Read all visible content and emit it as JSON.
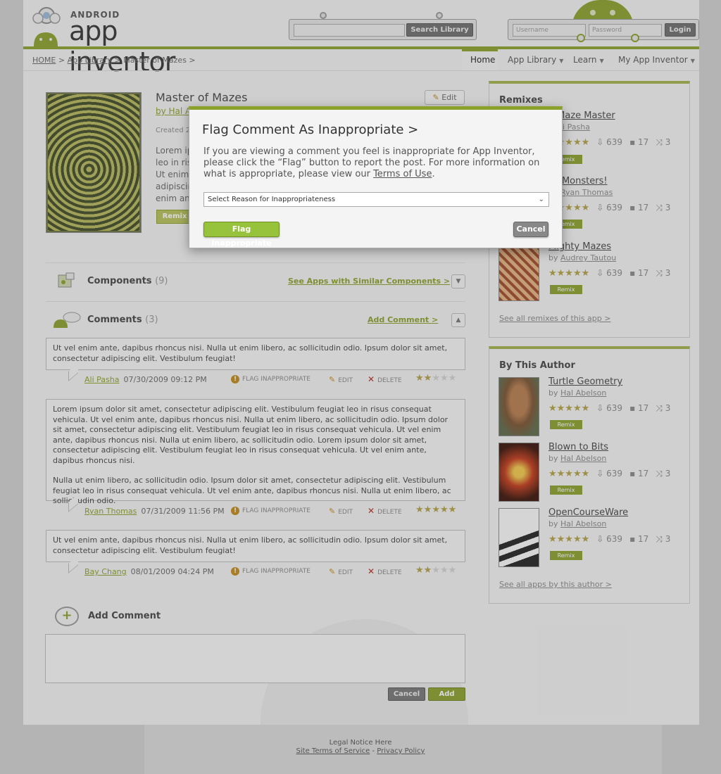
{
  "header": {
    "logo_small": "ANDROID",
    "logo_text": "app inventor",
    "search_button": "Search Library",
    "username_placeholder": "Username",
    "password_placeholder": "Password",
    "login_button": "Login"
  },
  "breadcrumb": {
    "home": "HOME",
    "sep1": " > ",
    "library": "App Library",
    "sep2": " > ",
    "current": "Master of Mazes >"
  },
  "nav": {
    "home": "Home",
    "library": "App Library",
    "learn": "Learn",
    "my": "My App Inventor",
    "chevron": "▼"
  },
  "app": {
    "title": "Master of Mazes",
    "by": "by Hal A",
    "created": "Created  2",
    "desc_lines": [
      "Lorem ip",
      "leo in ris",
      "Ut enim",
      "adipiscin",
      "enim an"
    ],
    "edit_label": "Edit",
    "remix_label": "Remix"
  },
  "components": {
    "title": "Components",
    "count": "(9)",
    "link": "See Apps with Similar Components >"
  },
  "comments": {
    "title": "Comments",
    "count": "(3)",
    "link": "Add Comment >",
    "flag_label": "FLAG INAPPROPRIATE",
    "edit_label": "EDIT",
    "delete_label": "DELETE",
    "items": [
      {
        "paragraphs": [
          "Ut vel enim ante, dapibus rhoncus nisi. Nulla ut enim libero, ac sollicitudin odio.  Ipsum dolor sit amet, consectetur adipiscing elit. Vestibulum feugiat!"
        ],
        "author": "Ali Pasha",
        "date": "07/30/2009 09:12 PM",
        "rating": 2
      },
      {
        "paragraphs": [
          "Lorem ipsum dolor sit amet, consectetur adipiscing elit. Vestibulum feugiat leo in risus consequat vehicula. Ut vel enim ante, dapibus rhoncus nisi. Nulla ut enim libero, ac sollicitudin odio.  Ipsum dolor sit amet, consectetur adipiscing elit. Vestibulum feugiat leo in risus consequat vehicula. Ut vel enim ante, dapibus rhoncus nisi. Nulla ut enim libero, ac sollicitudin odio. Lorem ipsum dolor sit amet, consectetur adipiscing elit. Vestibulum feugiat leo in risus consequat vehicula. Ut vel enim ante, dapibus rhoncus nisi.",
          "Nulla ut enim libero, ac sollicitudin odio.  Ipsum dolor sit amet, consectetur adipiscing elit. Vestibulum feugiat leo in risus consequat vehicula. Ut vel enim ante, dapibus rhoncus nisi. Nulla ut enim libero, ac sollicitudin odio."
        ],
        "author": "Ryan Thomas",
        "date": "07/31/2009 11:56 PM",
        "rating": 5
      },
      {
        "paragraphs": [
          "Ut vel enim ante, dapibus rhoncus nisi. Nulla ut enim libero, ac sollicitudin odio.  Ipsum dolor sit amet, consectetur adipiscing elit. Vestibulum feugiat!"
        ],
        "author": "Bay Chang",
        "date": "08/01/2009 04:24 PM",
        "rating": 2
      }
    ]
  },
  "add_comment": {
    "title": "Add Comment",
    "cancel": "Cancel",
    "add": "Add"
  },
  "remixes": {
    "title": "Remixes",
    "see_all": "See all remixes of this app >",
    "items": [
      {
        "title": "e Maze Master",
        "by_prefix": "by ",
        "author": "li Pasha",
        "downloads": "639",
        "comments": "17",
        "remixes": "3",
        "remix": "Remix"
      },
      {
        "title": "ze Monsters!",
        "by_prefix": "by ",
        "author": "Ryan Thomas",
        "downloads": "639",
        "comments": "17",
        "remixes": "3",
        "remix": "Remix"
      },
      {
        "title": "Mighty Mazes",
        "by_prefix": "by ",
        "author": "Audrey Tautou",
        "downloads": "639",
        "comments": "17",
        "remixes": "3",
        "remix": "Remix"
      }
    ]
  },
  "author": {
    "title": "By This Author",
    "see_all": "See all apps by this author >",
    "items": [
      {
        "title": "Turtle Geometry",
        "by_prefix": "by ",
        "author": "Hal Abelson",
        "downloads": "639",
        "comments": "17",
        "remixes": "3",
        "remix": "Remix"
      },
      {
        "title": "Blown to Bits",
        "by_prefix": "by ",
        "author": "Hal Abelson",
        "downloads": "639",
        "comments": "17",
        "remixes": "3",
        "remix": "Remix"
      },
      {
        "title": "OpenCourseWare",
        "by_prefix": "by ",
        "author": "Hal Abelson",
        "downloads": "639",
        "comments": "17",
        "remixes": "3",
        "remix": "Remix"
      }
    ]
  },
  "footer": {
    "legal": "Legal Notice Here",
    "terms": "Site Terms of Service",
    "sep": " - ",
    "privacy": "Privacy Policy"
  },
  "modal": {
    "title": "Flag Comment As Inappropriate >",
    "body_pre": "If you are viewing a comment you feel is inappropriate for App Inventor, please click the “Flag” button to report the post.  For more information on what is appropriate, please view our ",
    "terms_link": "Terms of Use",
    "body_post": ".",
    "select_value": "Select Reason for Inappropriateness",
    "flag_button": "Flag Inappropriate",
    "cancel_button": "Cancel"
  },
  "colors": {
    "accent": "#8aa12a",
    "star": "#b2a042",
    "flag_button": "#97c23b"
  }
}
